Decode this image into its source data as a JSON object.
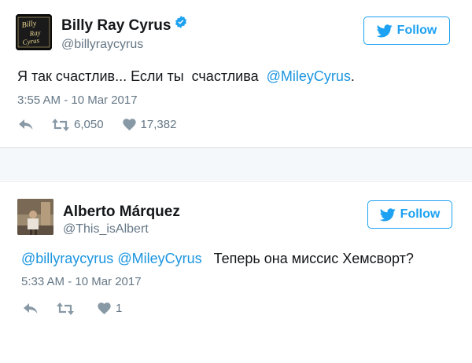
{
  "tweets": [
    {
      "author": {
        "name": "Billy Ray Cyrus",
        "handle": "@billyraycyrus",
        "verified": true
      },
      "avatar_text": [
        "Billy",
        "Ray",
        "Cyrus"
      ],
      "follow_label": "Follow",
      "text": {
        "plain": "Я так счастлив... Если ты  счастлива  ",
        "mention": "@MileyCyrus",
        "suffix": "."
      },
      "timestamp": "3:55 AM - 10 Mar 2017",
      "retweets": "6,050",
      "likes": "17,382"
    },
    {
      "author": {
        "name": "Alberto Márquez",
        "handle": "@This_isAlbert",
        "verified": false
      },
      "follow_label": "Follow",
      "text": {
        "mention1": "@billyraycyrus",
        "mention2": "@MileyCyrus",
        "plain": "Теперь она миссис Хемсворт?"
      },
      "timestamp": "5:33 AM - 10 Mar 2017",
      "retweets": "",
      "likes": "1"
    }
  ],
  "colors": {
    "accent": "#1da1f2",
    "mention": "#1b95e0",
    "muted": "#657786",
    "text": "#14171a"
  },
  "icons": [
    "verified-badge-icon",
    "twitter-bird-icon",
    "reply-icon",
    "retweet-icon",
    "heart-icon"
  ]
}
